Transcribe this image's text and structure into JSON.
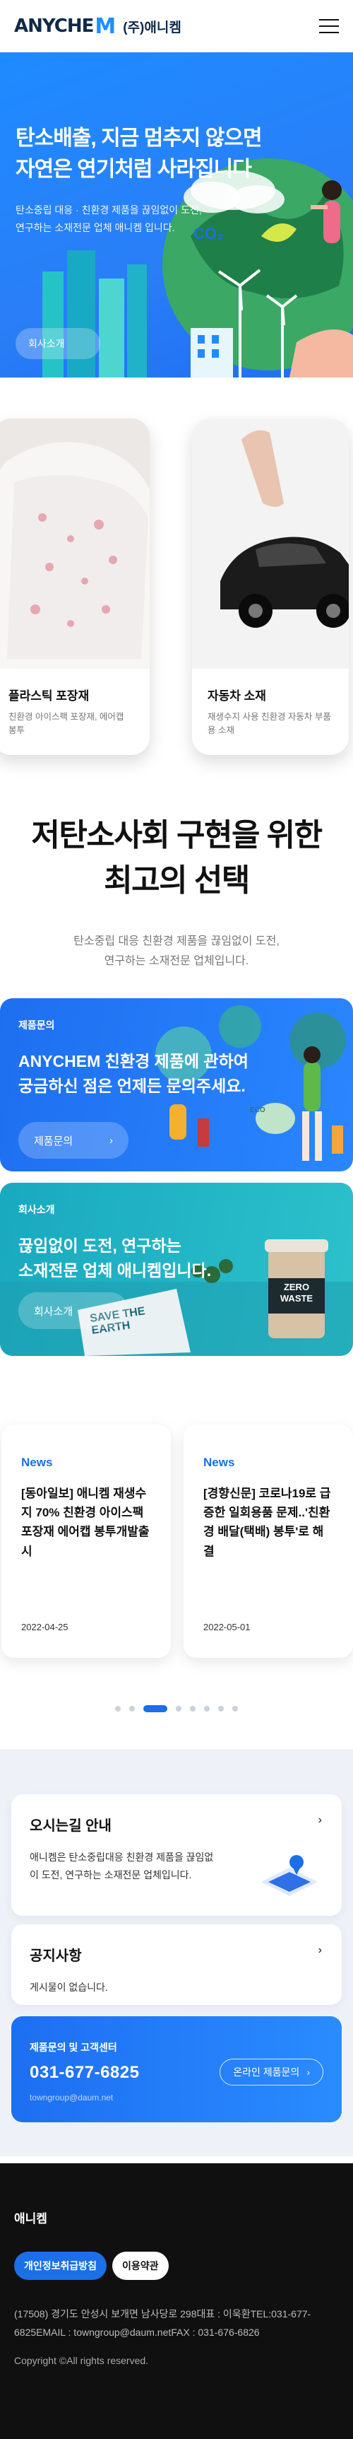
{
  "header": {
    "logo_word": "ANYCHE",
    "logo_m": "M",
    "logo_kr": "(주)애니켐"
  },
  "hero": {
    "title": "탄소배출, 지금 멈추지 않으면\n자연은 연기처럼 사라집니다",
    "desc": "탄소중립 대응 · 친환경 제품을 끊임없이 도전,\n연구하는 소재전문 업체 애니켐 입니다.",
    "button": "회사소개",
    "badge": "CO₂"
  },
  "products": [
    {
      "name": "플라스틱 포장재",
      "desc": "친환경 아이스팩 포장재, 에어캡 봉투"
    },
    {
      "name": "자동차 소재",
      "desc": "재생수지 사용 친환경 자동차 부품용 소재"
    }
  ],
  "headline": {
    "title": "저탄소사회 구현을 위한\n최고의 선택",
    "desc": "탄소중립 대응 친환경 제품을 끊임없이 도전,\n연구하는 소재전문 업체입니다."
  },
  "banner_inquiry": {
    "tag": "제품문의",
    "title": "ANYCHEM 친환경 제품에 관하여\n궁금하신 점은 언제든 문의주세요.",
    "button": "제품문의",
    "badge": "ECO"
  },
  "banner_company": {
    "tag": "회사소개",
    "title": "끊임없이 도전, 연구하는\n소재전문 업체 애니켐입니다.",
    "button": "회사소개",
    "sign": "SAVE THE EARTH",
    "cup": "ZERO WASTE"
  },
  "news": [
    {
      "tag": "News",
      "title": "[동아일보] 애니켐 재생수지 70% 친환경 아이스팩 포장재 에어캡 봉투개발출시",
      "date": "2022-04-25"
    },
    {
      "tag": "News",
      "title": "[경향신문] 코로나19로 급증한 일회용품 문제..'친환경 배달(택배) 봉투'로 해결",
      "date": "2022-05-01"
    }
  ],
  "dots": {
    "count": 8,
    "active_index": 2
  },
  "info": {
    "directions_title": "오시는길 안내",
    "directions_desc": "애니켐은 탄소중립대응 친환경 제품을 끊임없이 도전, 연구하는 소재전문 업체입니다.",
    "notice_title": "공지사항",
    "notice_desc": "게시물이 없습니다."
  },
  "cs": {
    "label": "제품문의 및 고객센터",
    "phone": "031-677-6825",
    "email": "towngroup@daum.net",
    "button": "온라인 제품문의"
  },
  "footer": {
    "brand": "애니켐",
    "link_privacy": "개인정보취급방침",
    "link_terms": "이용약관",
    "address": "(17508) 경기도 안성시 보개면 남사당로 298대표 : 이욱환TEL:031-677-6825EMAIL : towngroup@daum.netFAX : 031-676-6826",
    "copyright": "Copyright ©All rights reserved."
  },
  "colors": {
    "primary": "#1b6fe8",
    "hero_blue": "#1e8bff",
    "teal": "#1fb7c6",
    "footer_bg": "#101010"
  }
}
